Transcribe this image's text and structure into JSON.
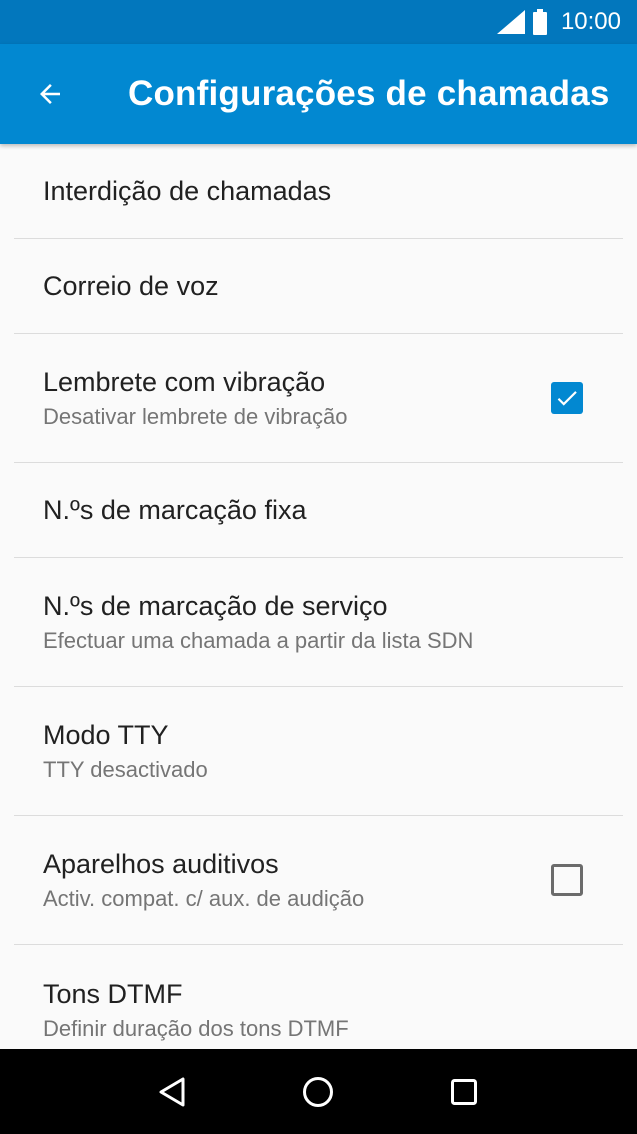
{
  "status": {
    "time": "10:00",
    "signal_icon": "signal-icon",
    "battery_icon": "battery-icon"
  },
  "app_bar": {
    "title": "Configurações de chamadas",
    "back_icon": "arrow-back-icon",
    "color": "#0288d1",
    "status_color": "#0277bd"
  },
  "items": [
    {
      "title": "Interdição de chamadas"
    },
    {
      "title": "Correio de voz"
    },
    {
      "title": "Lembrete com vibração",
      "subtitle": "Desativar lembrete de vibração",
      "checked": true
    },
    {
      "title": "N.ºs de marcação fixa"
    },
    {
      "title": "N.ºs de marcação de serviço",
      "subtitle": "Efectuar uma chamada a partir da lista SDN"
    },
    {
      "title": "Modo TTY",
      "subtitle": "TTY desactivado"
    },
    {
      "title": "Aparelhos auditivos",
      "subtitle": "Activ. compat. c/ aux. de audição",
      "checked": false
    },
    {
      "title": "Tons DTMF",
      "subtitle": "Definir duração dos tons DTMF"
    }
  ],
  "nav": {
    "back_icon": "nav-back-icon",
    "home_icon": "nav-home-icon",
    "recents_icon": "nav-recents-icon"
  }
}
